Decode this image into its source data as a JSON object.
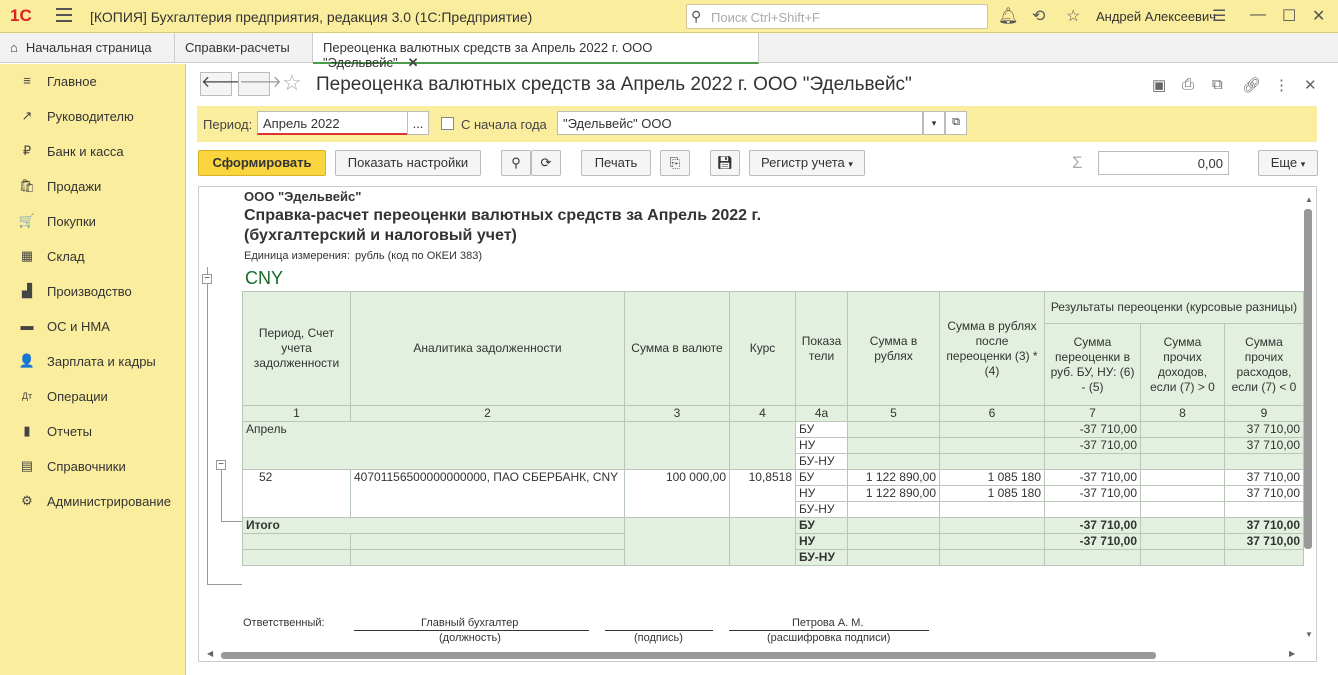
{
  "app": {
    "logo": "1С",
    "title": "[КОПИЯ] Бухгалтерия предприятия, редакция 3.0  (1С:Предприятие)",
    "search_placeholder": "Поиск Ctrl+Shift+F",
    "user": "Андрей Алексеевич"
  },
  "tabs": [
    {
      "label": "Начальная страница"
    },
    {
      "label": "Справки-расчеты"
    },
    {
      "label": "Переоценка валютных средств за Апрель 2022 г. ООО \"Эдельвейс\"",
      "close": "✕"
    }
  ],
  "sidebar": {
    "items": [
      {
        "label": "Главное",
        "icon": "≡"
      },
      {
        "label": "Руководителю",
        "icon": "↗"
      },
      {
        "label": "Банк и касса",
        "icon": "₽"
      },
      {
        "label": "Продажи",
        "icon": "🛍"
      },
      {
        "label": "Покупки",
        "icon": "🛒"
      },
      {
        "label": "Склад",
        "icon": "▦"
      },
      {
        "label": "Производство",
        "icon": "▟"
      },
      {
        "label": "ОС и НМА",
        "icon": "▬"
      },
      {
        "label": "Зарплата и кадры",
        "icon": "👤"
      },
      {
        "label": "Операции",
        "icon": "Дт"
      },
      {
        "label": "Отчеты",
        "icon": "▮"
      },
      {
        "label": "Справочники",
        "icon": "▤"
      },
      {
        "label": "Администрирование",
        "icon": "⚙"
      }
    ]
  },
  "document": {
    "title": "Переоценка валютных средств за Апрель 2022 г. ООО \"Эдельвейс\"",
    "period_label": "Период:",
    "period_value": "Апрель 2022",
    "period_btn": "...",
    "from_year_label": "С начала года",
    "org_value": "\"Эдельвейс\" ООО"
  },
  "toolbar": {
    "generate": "Сформировать",
    "show_settings": "Показать настройки",
    "print": "Печать",
    "register": "Регистр учета",
    "sum_value": "0,00",
    "more": "Еще"
  },
  "report": {
    "org": "ООО \"Эдельвейс\"",
    "title1": "Справка-расчет переоценки валютных средств за Апрель 2022 г.",
    "title2": "(бухгалтерский и налоговый учет)",
    "unit_label": "Единица измерения:",
    "unit_value": "рубль (код по ОКЕИ 383)",
    "currency": "CNY",
    "headers": {
      "period": "Период, Счет учета задолженности",
      "analytics": "Аналитика задолженности",
      "sum_cur": "Сумма в валюте",
      "rate": "Курс",
      "indicators": "Показа тели",
      "sum_rub": "Сумма в рублях",
      "sum_after": "Сумма в рублях после переоценки (3) * (4)",
      "results": "Результаты переоценки (курсовые разницы)",
      "reval": "Сумма переоценки в руб. БУ, НУ: (6) - (5)",
      "income": "Сумма прочих доходов, если (7) > 0",
      "expense": "Сумма прочих расходов, если (7) < 0"
    },
    "col_nums": [
      "1",
      "2",
      "3",
      "4",
      "4а",
      "5",
      "6",
      "7",
      "8",
      "9"
    ],
    "april_label": "Апрель",
    "april_rows": [
      {
        "ind": "БУ",
        "reval": "-37 710,00",
        "expense": "37 710,00"
      },
      {
        "ind": "НУ",
        "reval": "-37 710,00",
        "expense": "37 710,00"
      },
      {
        "ind": "БУ-НУ",
        "reval": "",
        "expense": ""
      }
    ],
    "account": "52",
    "analytics_value": "40701156500000000000, ПАО СБЕРБАНК, CNY",
    "sum_cur": "100 000,00",
    "rate": "10,8518",
    "acc_rows": [
      {
        "ind": "БУ",
        "sum_rub": "1 122 890,00",
        "sum_after": "1 085 180",
        "reval": "-37 710,00",
        "expense": "37 710,00"
      },
      {
        "ind": "НУ",
        "sum_rub": "1 122 890,00",
        "sum_after": "1 085 180",
        "reval": "-37 710,00",
        "expense": "37 710,00"
      },
      {
        "ind": "БУ-НУ",
        "sum_rub": "",
        "sum_after": "",
        "reval": "",
        "expense": ""
      }
    ],
    "total_label": "Итого",
    "total_rows": [
      {
        "ind": "БУ",
        "reval": "-37 710,00",
        "expense": "37 710,00"
      },
      {
        "ind": "НУ",
        "reval": "-37 710,00",
        "expense": "37 710,00"
      },
      {
        "ind": "БУ-НУ",
        "reval": "",
        "expense": ""
      }
    ],
    "responsible_label": "Ответственный:",
    "position": "Главный бухгалтер",
    "position_caption": "(должность)",
    "signature_caption": "(подпись)",
    "name": "Петрова А. М.",
    "name_caption": "(расшифровка подписи)"
  }
}
